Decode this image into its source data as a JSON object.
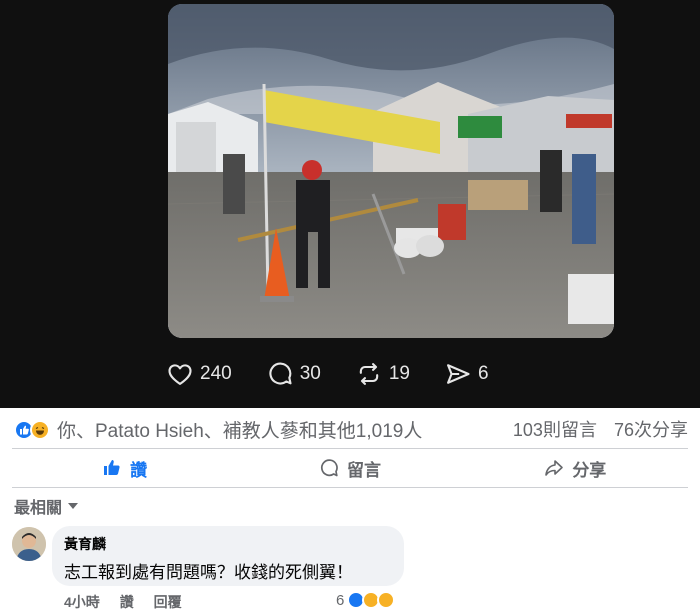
{
  "post": {
    "stats": {
      "likes": "240",
      "comments": "30",
      "reposts": "19",
      "shares": "6"
    }
  },
  "reactions": {
    "names_text": "你、Patato Hsieh、補教人蔘和其他1,019人",
    "comment_count": "103則留言",
    "share_count": "76次分享",
    "icons": [
      "like-icon",
      "haha-icon"
    ]
  },
  "actions": {
    "like": "讚",
    "comment": "留言",
    "share": "分享"
  },
  "sort": {
    "label": "最相關"
  },
  "comment": {
    "author": "黃育麟",
    "text": "志工報到處有問題嗎？收錢的死側翼！",
    "time": "4小時",
    "like": "讚",
    "reply": "回覆",
    "reaction_count": "6",
    "reaction_icons": [
      "like-icon",
      "haha-icon",
      "wow-icon"
    ]
  },
  "colors": {
    "accent": "#1877f2",
    "embed_bg": "#101010",
    "bubble_bg": "#f0f2f5"
  }
}
